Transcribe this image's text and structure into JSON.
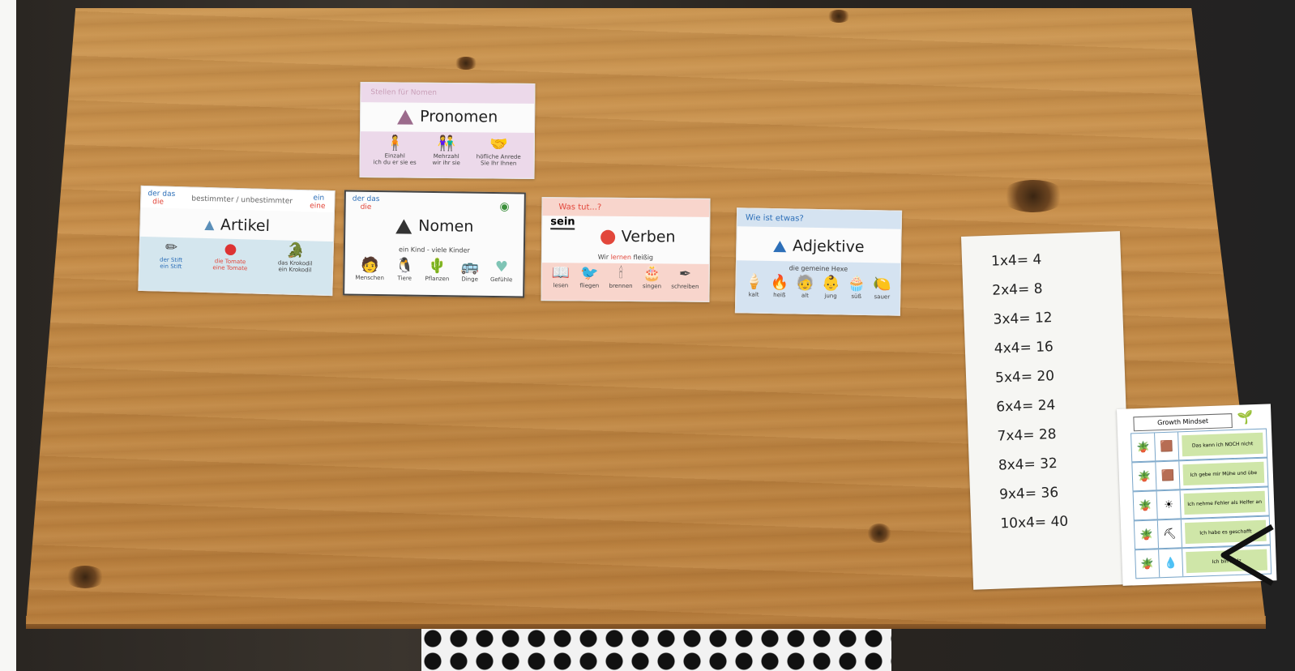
{
  "scene": "wooden table with German grammar posters and a times-table strip",
  "colors": {
    "wood": "#c58c48",
    "artikel_band": "#d4e6ee",
    "pronomen_band": "#ecd9ea",
    "verben_band": "#f8d5cc",
    "adjektive_band": "#d5e3f1",
    "noun_triangle": "#333333",
    "artikel_triangle": "#5b8fb9",
    "pronomen_triangle": "#9b6b8c",
    "verben_circle": "#e2473b",
    "adjektive_triangle": "#2d6fb8"
  },
  "cards": {
    "pronomen": {
      "header": "Stellen für Nomen",
      "title": "Pronomen",
      "captions": [
        "Einzahl",
        "Mehrzahl",
        "höfliche Anrede"
      ],
      "subcaptions": [
        "ich du er sie es",
        "wir ihr sie",
        "Sie Ihr Ihnen"
      ]
    },
    "artikel": {
      "header": "bestimmter / unbestimmter",
      "header_left": "der das",
      "header_left2": "die",
      "header_right": "ein",
      "header_right2": "eine",
      "title": "Artikel",
      "lines": [
        "der Stift",
        "die Tomate",
        "das Krokodil",
        "ein Stift",
        "eine Tomate",
        "ein Krokodil"
      ]
    },
    "nomen": {
      "header_left": "der das",
      "header_left2": "die",
      "title": "Nomen",
      "subtitle": "ein Kind - viele Kinder",
      "captions": [
        "Menschen",
        "Tiere",
        "Pflanzen",
        "Dinge",
        "Gefühle"
      ]
    },
    "verben": {
      "header": "Was tut...?",
      "side": "sein",
      "title": "Verben",
      "subtitle_prefix": "Wir",
      "subtitle_highlight": "lernen",
      "subtitle_suffix": "fleißig",
      "captions": [
        "lesen",
        "fliegen",
        "brennen",
        "singen",
        "schreiben"
      ]
    },
    "adjektive": {
      "header": "Wie ist etwas?",
      "title": "Adjektive",
      "subtitle": "die gemeine Hexe",
      "captions": [
        "kalt",
        "heiß",
        "alt",
        "jung",
        "süß",
        "sauer"
      ]
    }
  },
  "times_table": [
    "1x4= 4",
    "2x4= 8",
    "3x4= 12",
    "4x4= 16",
    "5x4= 20",
    "6x4= 24",
    "7x4= 28",
    "8x4= 32",
    "9x4= 36",
    "10x4= 40"
  ],
  "growth_poster": {
    "title": "Growth Mindset",
    "rows": [
      "Das kann ich NOCH nicht",
      "Ich gebe mir Mühe und übe",
      "Ich nehme Fehler als Helfer an",
      "Ich habe es geschafft",
      "Ich bin stolz"
    ]
  }
}
